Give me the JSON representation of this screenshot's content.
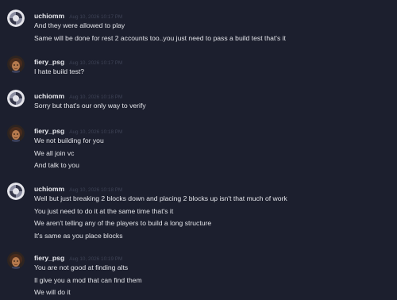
{
  "messages": [
    {
      "username": "uchiomm",
      "timestamp": "Aug 10, 2026 10:17 PM",
      "lines": [
        "And they were allowed to play",
        "Same will be done for rest 2 accounts too..you just need to pass a build test that's it"
      ]
    },
    {
      "username": "fiery_psg",
      "timestamp": "Aug 10, 2026 10:17 PM",
      "lines": [
        "I hate build test?"
      ]
    },
    {
      "username": "uchiomm",
      "timestamp": "Aug 10, 2026 10:18 PM",
      "lines": [
        "Sorry but that's our only way to verify"
      ]
    },
    {
      "username": "fiery_psg",
      "timestamp": "Aug 10, 2026 10:18 PM",
      "lines": [
        "We not building for you",
        "We all join vc",
        "And talk to you"
      ]
    },
    {
      "username": "uchiomm",
      "timestamp": "Aug 10, 2026 10:18 PM",
      "lines": [
        "Well but just breaking 2 blocks down and placing 2 blocks up isn't that much of work",
        "You just need to do it at the same time that's it",
        "We aren't telling any of the players to build a long structure",
        "It's same as you place blocks"
      ]
    },
    {
      "username": "fiery_psg",
      "timestamp": "Aug 10, 2026 10:19 PM",
      "lines": [
        "You are not good at finding alts",
        "Il give you a mod that can find them",
        "We will do it"
      ]
    }
  ],
  "colors": {
    "background": "#1c1f2e",
    "username": "#e8e9ee",
    "message_text": "#e3e4e9",
    "timestamp": "#3e4356"
  },
  "avatars": {
    "uchiomm": "swirl-avatar-icon",
    "fiery_psg": "portrait-avatar-icon"
  }
}
